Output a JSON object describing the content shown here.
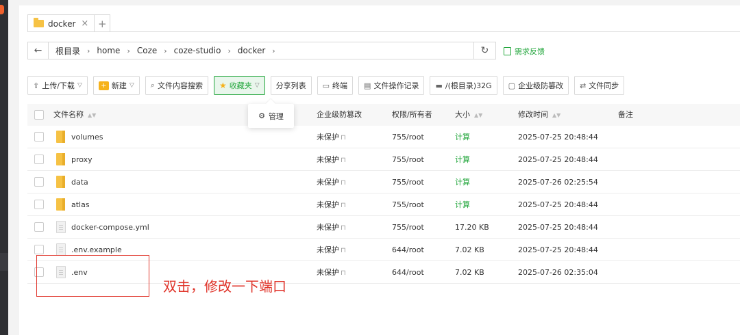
{
  "tab": {
    "label": "docker",
    "close": "×",
    "add": "+"
  },
  "address": {
    "back": "←",
    "crumbs": [
      "根目录",
      "home",
      "Coze",
      "coze-studio",
      "docker"
    ],
    "sep": "›",
    "refresh": "↻",
    "feedback": "需求反馈"
  },
  "toolbar": {
    "upload": "上传/下载",
    "new": "新建",
    "search": "文件内容搜索",
    "favorites": "收藏夹",
    "share": "分享列表",
    "terminal": "终端",
    "oplog": "文件操作记录",
    "disk": "/(根目录)32G",
    "tamper": "企业级防篡改",
    "sync": "文件同步"
  },
  "popup": {
    "label": "管理"
  },
  "table": {
    "headers": {
      "name": "文件名称",
      "protect": "企业级防篡改",
      "perm": "权限/所有者",
      "size": "大小",
      "mtime": "修改时间",
      "note": "备注"
    },
    "rows": [
      {
        "name": "volumes",
        "type": "folder",
        "protect": "未保护",
        "perm": "755/root",
        "size": "计算",
        "mtime": "2025-07-25 20:48:44"
      },
      {
        "name": "proxy",
        "type": "folder",
        "protect": "未保护",
        "perm": "755/root",
        "size": "计算",
        "mtime": "2025-07-25 20:48:44"
      },
      {
        "name": "data",
        "type": "folder",
        "protect": "未保护",
        "perm": "755/root",
        "size": "计算",
        "mtime": "2025-07-26 02:25:54"
      },
      {
        "name": "atlas",
        "type": "folder",
        "protect": "未保护",
        "perm": "755/root",
        "size": "计算",
        "mtime": "2025-07-25 20:48:44"
      },
      {
        "name": "docker-compose.yml",
        "type": "file",
        "protect": "未保护",
        "perm": "755/root",
        "size": "17.20 KB",
        "mtime": "2025-07-25 20:48:44"
      },
      {
        "name": ".env.example",
        "type": "file",
        "protect": "未保护",
        "perm": "644/root",
        "size": "7.02 KB",
        "mtime": "2025-07-25 20:48:44"
      },
      {
        "name": ".env",
        "type": "file",
        "protect": "未保护",
        "perm": "644/root",
        "size": "7.02 KB",
        "mtime": "2025-07-26 02:35:04"
      }
    ]
  },
  "annotation": "双击，修改一下端口",
  "colors": {
    "accent": "#20a53a",
    "annotation": "#e0352b",
    "folder": "#f6c244"
  }
}
